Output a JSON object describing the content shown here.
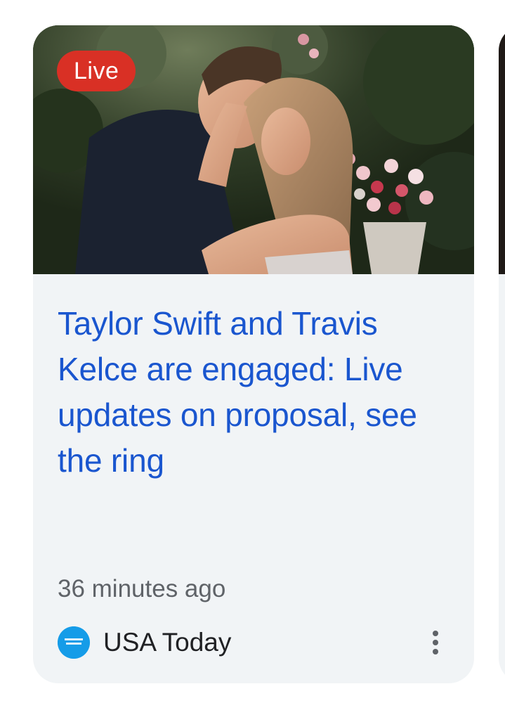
{
  "card": {
    "badge": "Live",
    "headline": "Taylor Swift and Travis Kelce are engaged: Live updates on proposal, see the ring",
    "timestamp": "36 minutes ago",
    "source": {
      "name": "USA Today",
      "logo_icon": "usa-today-logo"
    },
    "more_icon": "more-vert-icon"
  },
  "colors": {
    "headline": "#1a56cf",
    "badge_bg": "#d93025",
    "card_bg": "#f1f4f6",
    "source_logo": "#159ce8"
  }
}
